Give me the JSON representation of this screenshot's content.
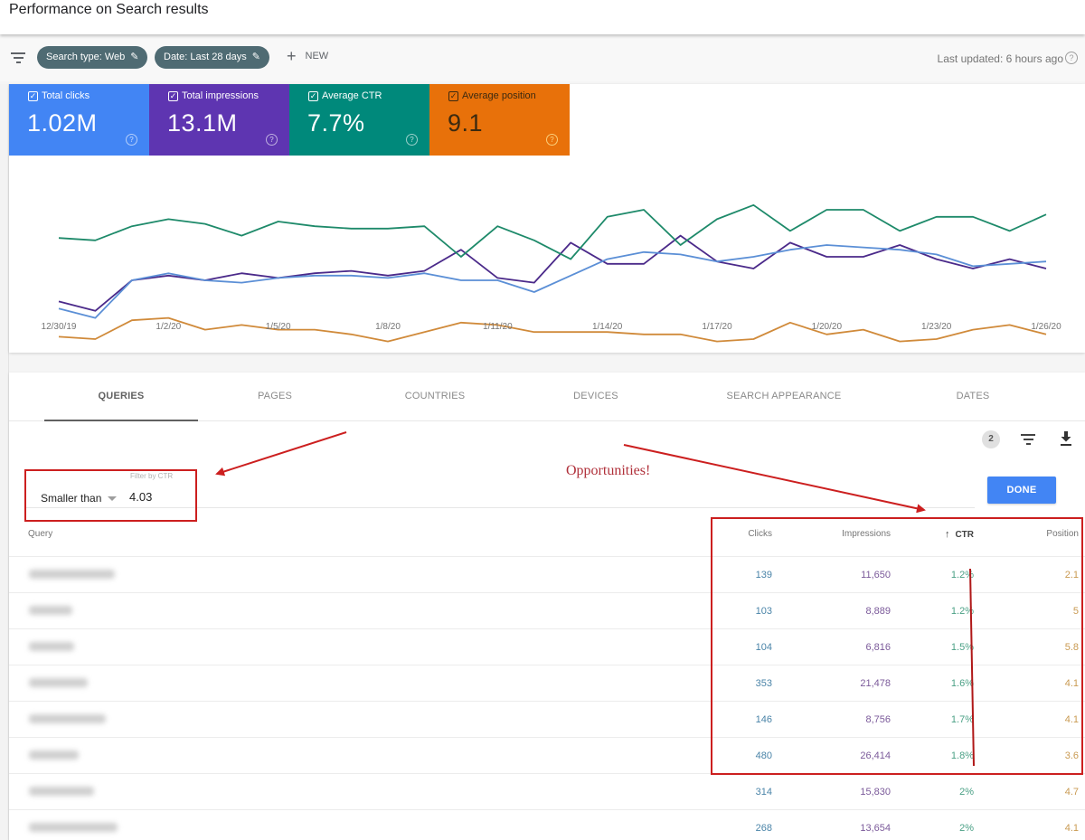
{
  "header": {
    "title": "Performance on Search results"
  },
  "filterbar": {
    "filter_icon": "filter-list-icon",
    "chips": [
      {
        "label": "Search type: Web",
        "icon": "edit-pencil-icon"
      },
      {
        "label": "Date: Last 28 days",
        "icon": "edit-pencil-icon"
      }
    ],
    "new_label": "NEW",
    "new_icon": "plus-icon",
    "last_updated": "Last updated: 6 hours ago",
    "help_icon": "help-circle-icon"
  },
  "metrics": [
    {
      "label": "Total clicks",
      "value": "1.02M",
      "checked": true,
      "color": "#4285f4"
    },
    {
      "label": "Total impressions",
      "value": "13.1M",
      "checked": true,
      "color": "#5e35b1"
    },
    {
      "label": "Average CTR",
      "value": "7.7%",
      "checked": true,
      "color": "#00897b"
    },
    {
      "label": "Average position",
      "value": "9.1",
      "checked": true,
      "color": "#e8710a"
    }
  ],
  "chart_data": {
    "type": "line",
    "title": "",
    "xlabel": "",
    "ylabel": "",
    "note": "No y-axis shown; values are relative heights on a 0-100 plot scale read from the screenshot.",
    "x": [
      "12/30/19",
      "12/31/19",
      "1/1/20",
      "1/2/20",
      "1/3/20",
      "1/4/20",
      "1/5/20",
      "1/6/20",
      "1/7/20",
      "1/8/20",
      "1/9/20",
      "1/10/20",
      "1/11/20",
      "1/12/20",
      "1/13/20",
      "1/14/20",
      "1/15/20",
      "1/16/20",
      "1/17/20",
      "1/18/20",
      "1/19/20",
      "1/20/20",
      "1/21/20",
      "1/22/20",
      "1/23/20",
      "1/24/20",
      "1/25/20",
      "1/26/20"
    ],
    "x_tick_labels": [
      "12/30/19",
      "1/2/20",
      "1/5/20",
      "1/8/20",
      "1/11/20",
      "1/14/20",
      "1/17/20",
      "1/20/20",
      "1/23/20",
      "1/26/20"
    ],
    "ylim": [
      0,
      100
    ],
    "grid": false,
    "series": [
      {
        "name": "Average CTR",
        "color": "#1e8a6a",
        "values": [
          63,
          62,
          68,
          71,
          69,
          64,
          70,
          68,
          67,
          67,
          68,
          55,
          68,
          62,
          54,
          72,
          75,
          60,
          71,
          77,
          66,
          75,
          75,
          66,
          72,
          72,
          66,
          73
        ]
      },
      {
        "name": "Total impressions",
        "color": "#4b2a8a",
        "values": [
          36,
          32,
          45,
          47,
          45,
          48,
          46,
          48,
          49,
          47,
          49,
          58,
          46,
          44,
          61,
          52,
          52,
          64,
          53,
          50,
          61,
          55,
          55,
          60,
          54,
          50,
          54,
          50
        ]
      },
      {
        "name": "Total clicks",
        "color": "#5b8fd6",
        "values": [
          33,
          29,
          45,
          48,
          45,
          44,
          46,
          47,
          47,
          46,
          48,
          45,
          45,
          40,
          47,
          54,
          57,
          56,
          53,
          55,
          58,
          60,
          59,
          58,
          56,
          51,
          52,
          53
        ]
      },
      {
        "name": "Average position",
        "color": "#d08a3a",
        "values": [
          21,
          20,
          28,
          29,
          24,
          26,
          24,
          24,
          22,
          19,
          23,
          27,
          26,
          23,
          23,
          23,
          22,
          22,
          19,
          20,
          27,
          22,
          24,
          19,
          20,
          24,
          26,
          22
        ]
      }
    ]
  },
  "tabs": [
    {
      "label": "QUERIES",
      "active": true
    },
    {
      "label": "PAGES",
      "active": false
    },
    {
      "label": "COUNTRIES",
      "active": false
    },
    {
      "label": "DEVICES",
      "active": false
    },
    {
      "label": "SEARCH APPEARANCE",
      "active": false
    },
    {
      "label": "DATES",
      "active": false
    }
  ],
  "table_toolbar": {
    "filter_count": "2",
    "filter_icon": "filter-list-icon",
    "download_icon": "download-icon"
  },
  "filter": {
    "label": "Filter by CTR",
    "operator": "Smaller than",
    "value": "4.03",
    "done_label": "DONE"
  },
  "table": {
    "columns": [
      "Query",
      "Clicks",
      "Impressions",
      "CTR",
      "Position"
    ],
    "sort_column": "CTR",
    "sort_icon": "arrow-upward-icon",
    "rows": [
      {
        "query": "(blurred)",
        "clicks": "139",
        "impressions": "11,650",
        "ctr": "1.2%",
        "position": "2.1"
      },
      {
        "query": "(blurred)",
        "clicks": "103",
        "impressions": "8,889",
        "ctr": "1.2%",
        "position": "5"
      },
      {
        "query": "(blurred)",
        "clicks": "104",
        "impressions": "6,816",
        "ctr": "1.5%",
        "position": "5.8"
      },
      {
        "query": "(blurred)",
        "clicks": "353",
        "impressions": "21,478",
        "ctr": "1.6%",
        "position": "4.1"
      },
      {
        "query": "(blurred)",
        "clicks": "146",
        "impressions": "8,756",
        "ctr": "1.7%",
        "position": "4.1"
      },
      {
        "query": "(blurred)",
        "clicks": "480",
        "impressions": "26,414",
        "ctr": "1.8%",
        "position": "3.6"
      },
      {
        "query": "(blurred)",
        "clicks": "314",
        "impressions": "15,830",
        "ctr": "2%",
        "position": "4.7"
      },
      {
        "query": "(blurred)",
        "clicks": "268",
        "impressions": "13,654",
        "ctr": "2%",
        "position": "4.1"
      }
    ]
  },
  "annotations": {
    "callout_text": "Opportunities!",
    "color": "#cc1f1f"
  }
}
